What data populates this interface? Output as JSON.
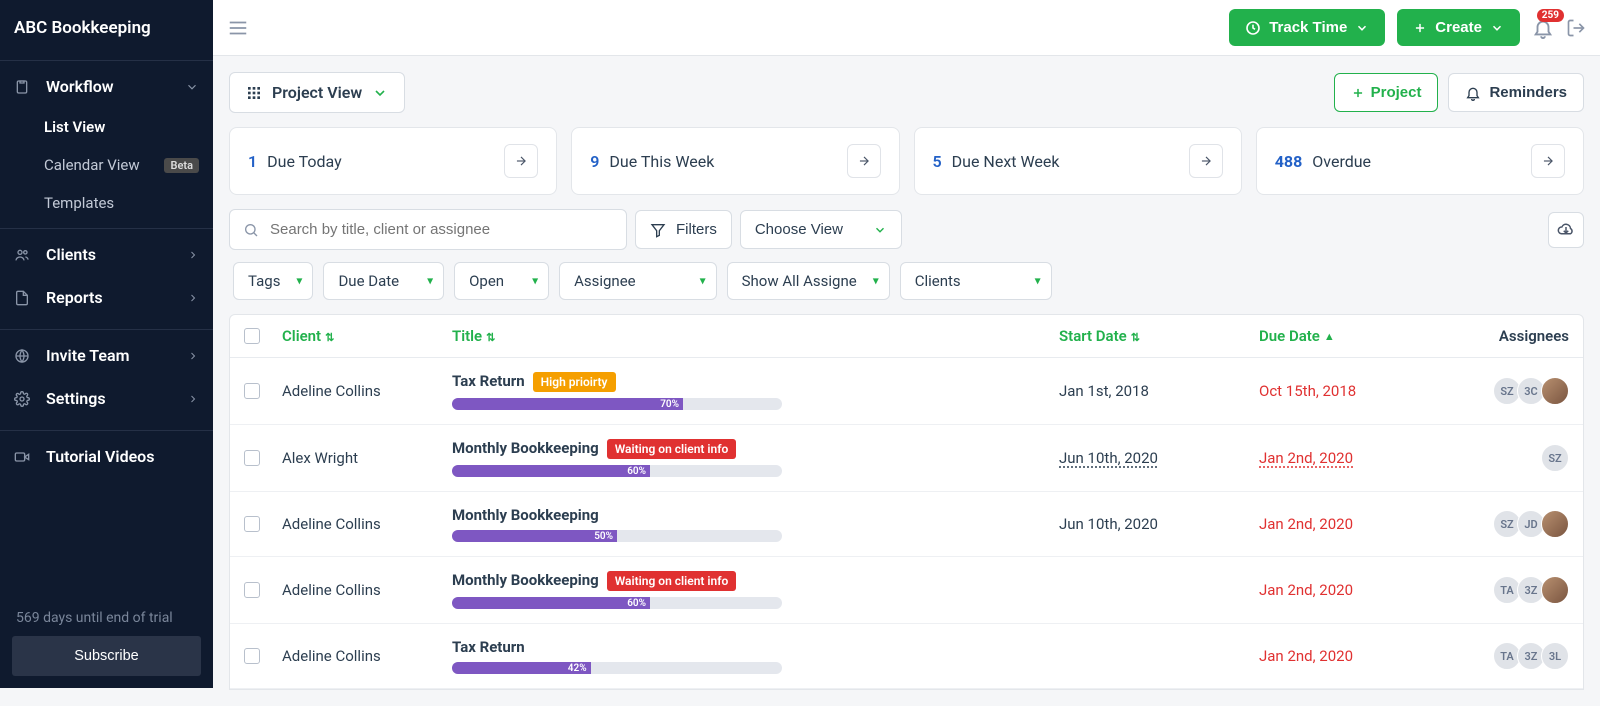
{
  "brand": "ABC Bookkeeping",
  "sidebar": {
    "workflow": "Workflow",
    "list_view": "List View",
    "calendar_view": "Calendar View",
    "beta": "Beta",
    "templates": "Templates",
    "clients": "Clients",
    "reports": "Reports",
    "invite_team": "Invite Team",
    "settings": "Settings",
    "tutorial_videos": "Tutorial Videos",
    "trial_text": "569 days until end of trial",
    "subscribe": "Subscribe"
  },
  "topbar": {
    "track_time": "Track Time",
    "create": "Create",
    "notif_count": "259"
  },
  "row1": {
    "project_view": "Project View",
    "project_btn": "Project",
    "reminders": "Reminders"
  },
  "stats": {
    "due_today_n": "1",
    "due_today": "Due Today",
    "due_week_n": "9",
    "due_week": "Due This Week",
    "due_next_n": "5",
    "due_next": "Due Next Week",
    "overdue_n": "488",
    "overdue": "Overdue"
  },
  "toolbar": {
    "search_placeholder": "Search by title, client or assignee",
    "filters": "Filters",
    "choose_view": "Choose View"
  },
  "chips": {
    "tags": "Tags",
    "due_date": "Due Date",
    "open": "Open",
    "assignee": "Assignee",
    "show_all": "Show All Assigne",
    "clients": "Clients"
  },
  "thead": {
    "client": "Client",
    "title": "Title",
    "start_date": "Start Date",
    "due_date": "Due Date",
    "assignees": "Assignees"
  },
  "rows": [
    {
      "client": "Adeline Collins",
      "title": "Tax Return",
      "badge": "High prioirty",
      "badge_color": "orange",
      "progress": 70,
      "prog_label": "70%",
      "start": "Jan 1st, 2018",
      "due": "Oct 15th, 2018",
      "assignees": [
        "SZ",
        "3C",
        "photo"
      ]
    },
    {
      "client": "Alex Wright",
      "title": "Monthly Bookkeeping",
      "badge": "Waiting on client info",
      "badge_color": "red",
      "progress": 60,
      "prog_label": "60%",
      "start": "Jun 10th, 2020",
      "start_under": true,
      "due": "Jan 2nd, 2020",
      "due_under": true,
      "assignees": [
        "SZ"
      ]
    },
    {
      "client": "Adeline Collins",
      "title": "Monthly Bookkeeping",
      "progress": 50,
      "prog_label": "50%",
      "start": "Jun 10th, 2020",
      "due": "Jan 2nd, 2020",
      "assignees": [
        "SZ",
        "JD",
        "photo"
      ]
    },
    {
      "client": "Adeline Collins",
      "title": "Monthly Bookkeeping",
      "badge": "Waiting on client info",
      "badge_color": "red",
      "progress": 60,
      "prog_label": "60%",
      "start": "",
      "due": "Jan 2nd, 2020",
      "assignees": [
        "TA",
        "3Z",
        "photo"
      ]
    },
    {
      "client": "Adeline Collins",
      "title": "Tax Return",
      "progress": 42,
      "prog_label": "42%",
      "start": "",
      "due": "Jan 2nd, 2020",
      "assignees": [
        "TA",
        "3Z",
        "3L"
      ]
    }
  ]
}
